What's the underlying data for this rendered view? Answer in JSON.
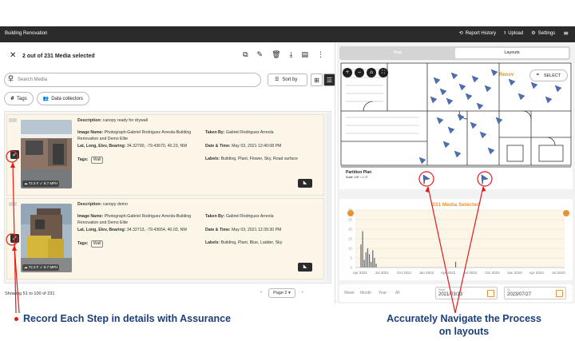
{
  "topbar": {
    "app_title": "Building Renovation",
    "report_history": "Report History",
    "upload": "Upload",
    "settings": "Settings"
  },
  "selection": {
    "count_text": "2 out of 231 Media selected"
  },
  "search": {
    "placeholder": "Search Media",
    "sort_label": "Sort by"
  },
  "chips": {
    "tags": "Tags",
    "collectors": "Data collectors"
  },
  "cards": [
    {
      "description_label": "Description:",
      "description": "canopy ready for drywall",
      "image_name_label": "Image Name:",
      "image_name": "Photograph-Gabriel Rodriguez Arreola-Building Renovation and Demo Elite",
      "taken_by_label": "Taken By:",
      "taken_by": "Gabriel Rodriguez Arreola",
      "coords_label": "Lat, Long, Elev, Bearing:",
      "coords": "34.32700, -79.43670, 40.23, NW",
      "datetime_label": "Date & Time:",
      "datetime": "May 03, 2021 12:40:08 PM",
      "tags_label": "Tags:",
      "tag": "Wall",
      "labels_label": "Labels:",
      "labels": "Building, Plant, Flower, Sky, Road surface",
      "temp": "72.3 F",
      "wind": "8.7 MPH"
    },
    {
      "description_label": "Description:",
      "description": "canopy demo",
      "image_name_label": "Image Name:",
      "image_name": "Photograph-Gabriel Rodriguez Arreola-Building Renovation and Demo Elite",
      "taken_by_label": "Taken By:",
      "taken_by": "Gabriel Rodriguez Arreola",
      "coords_label": "Lat, Long, Elev, Bearing:",
      "coords": "34.32713, -79.43654, 40.03, NW",
      "datetime_label": "Date & Time:",
      "datetime": "May 03, 2021 12:39:30 PM",
      "tags_label": "Tags:",
      "tag": "Wall",
      "labels_label": "Labels:",
      "labels": "Building, Plant, Blue, Ladder, Sky",
      "temp": "72.3 F",
      "wind": "8.7 MPH"
    }
  ],
  "footer": {
    "showing": "Showing 51 to 100 of 231",
    "page": "Page 2"
  },
  "right_panel": {
    "tab_map": "Map",
    "tab_layouts": "Layouts",
    "select_label": "SELECT",
    "plan_label": "Partition Plan",
    "plan_scale": "Scale: 1/8\" = 1'-0\"",
    "map_overlay_text": "Renov",
    "chart_title": "231 Media Selected",
    "date_from_label": "From",
    "date_from": "2021/03/13",
    "date_to_label": "To",
    "date_to": "2023/07/27",
    "range_options": [
      "Week",
      "Month",
      "Year",
      "All"
    ]
  },
  "chart_data": {
    "type": "bar",
    "title": "231 Media Selected",
    "x_ticks": [
      "Apr 2021",
      "Jul 2021",
      "Oct 2021",
      "Jan 2022",
      "Apr 2022",
      "Jul 2022",
      "Oct 2022",
      "Jan 2023",
      "Apr 2023",
      "Jul 2023"
    ],
    "y_ticks": [
      0,
      5,
      10,
      15,
      20,
      25,
      30
    ],
    "ylim": [
      0,
      30
    ],
    "bars": [
      {
        "date": "2021-04-05",
        "value": 12
      },
      {
        "date": "2021-04-12",
        "value": 19
      },
      {
        "date": "2021-04-19",
        "value": 4
      },
      {
        "date": "2021-04-26",
        "value": 8
      },
      {
        "date": "2021-05-03",
        "value": 10
      },
      {
        "date": "2021-05-10",
        "value": 7
      },
      {
        "date": "2021-05-17",
        "value": 3
      },
      {
        "date": "2021-05-24",
        "value": 9
      },
      {
        "date": "2021-05-31",
        "value": 5
      },
      {
        "date": "2021-06-07",
        "value": 2
      },
      {
        "date": "2022-05-02",
        "value": 3
      }
    ]
  },
  "annotations": {
    "left_caption": "Record Each Step in details with Assurance",
    "right_caption": "Accurately Navigate the Process on layouts",
    "right_caption_line1": "Accurately Navigate the Process",
    "right_caption_line2": "on layouts",
    "arrow_color": "#e31b1b",
    "caption_color": "#1b3f7a"
  }
}
